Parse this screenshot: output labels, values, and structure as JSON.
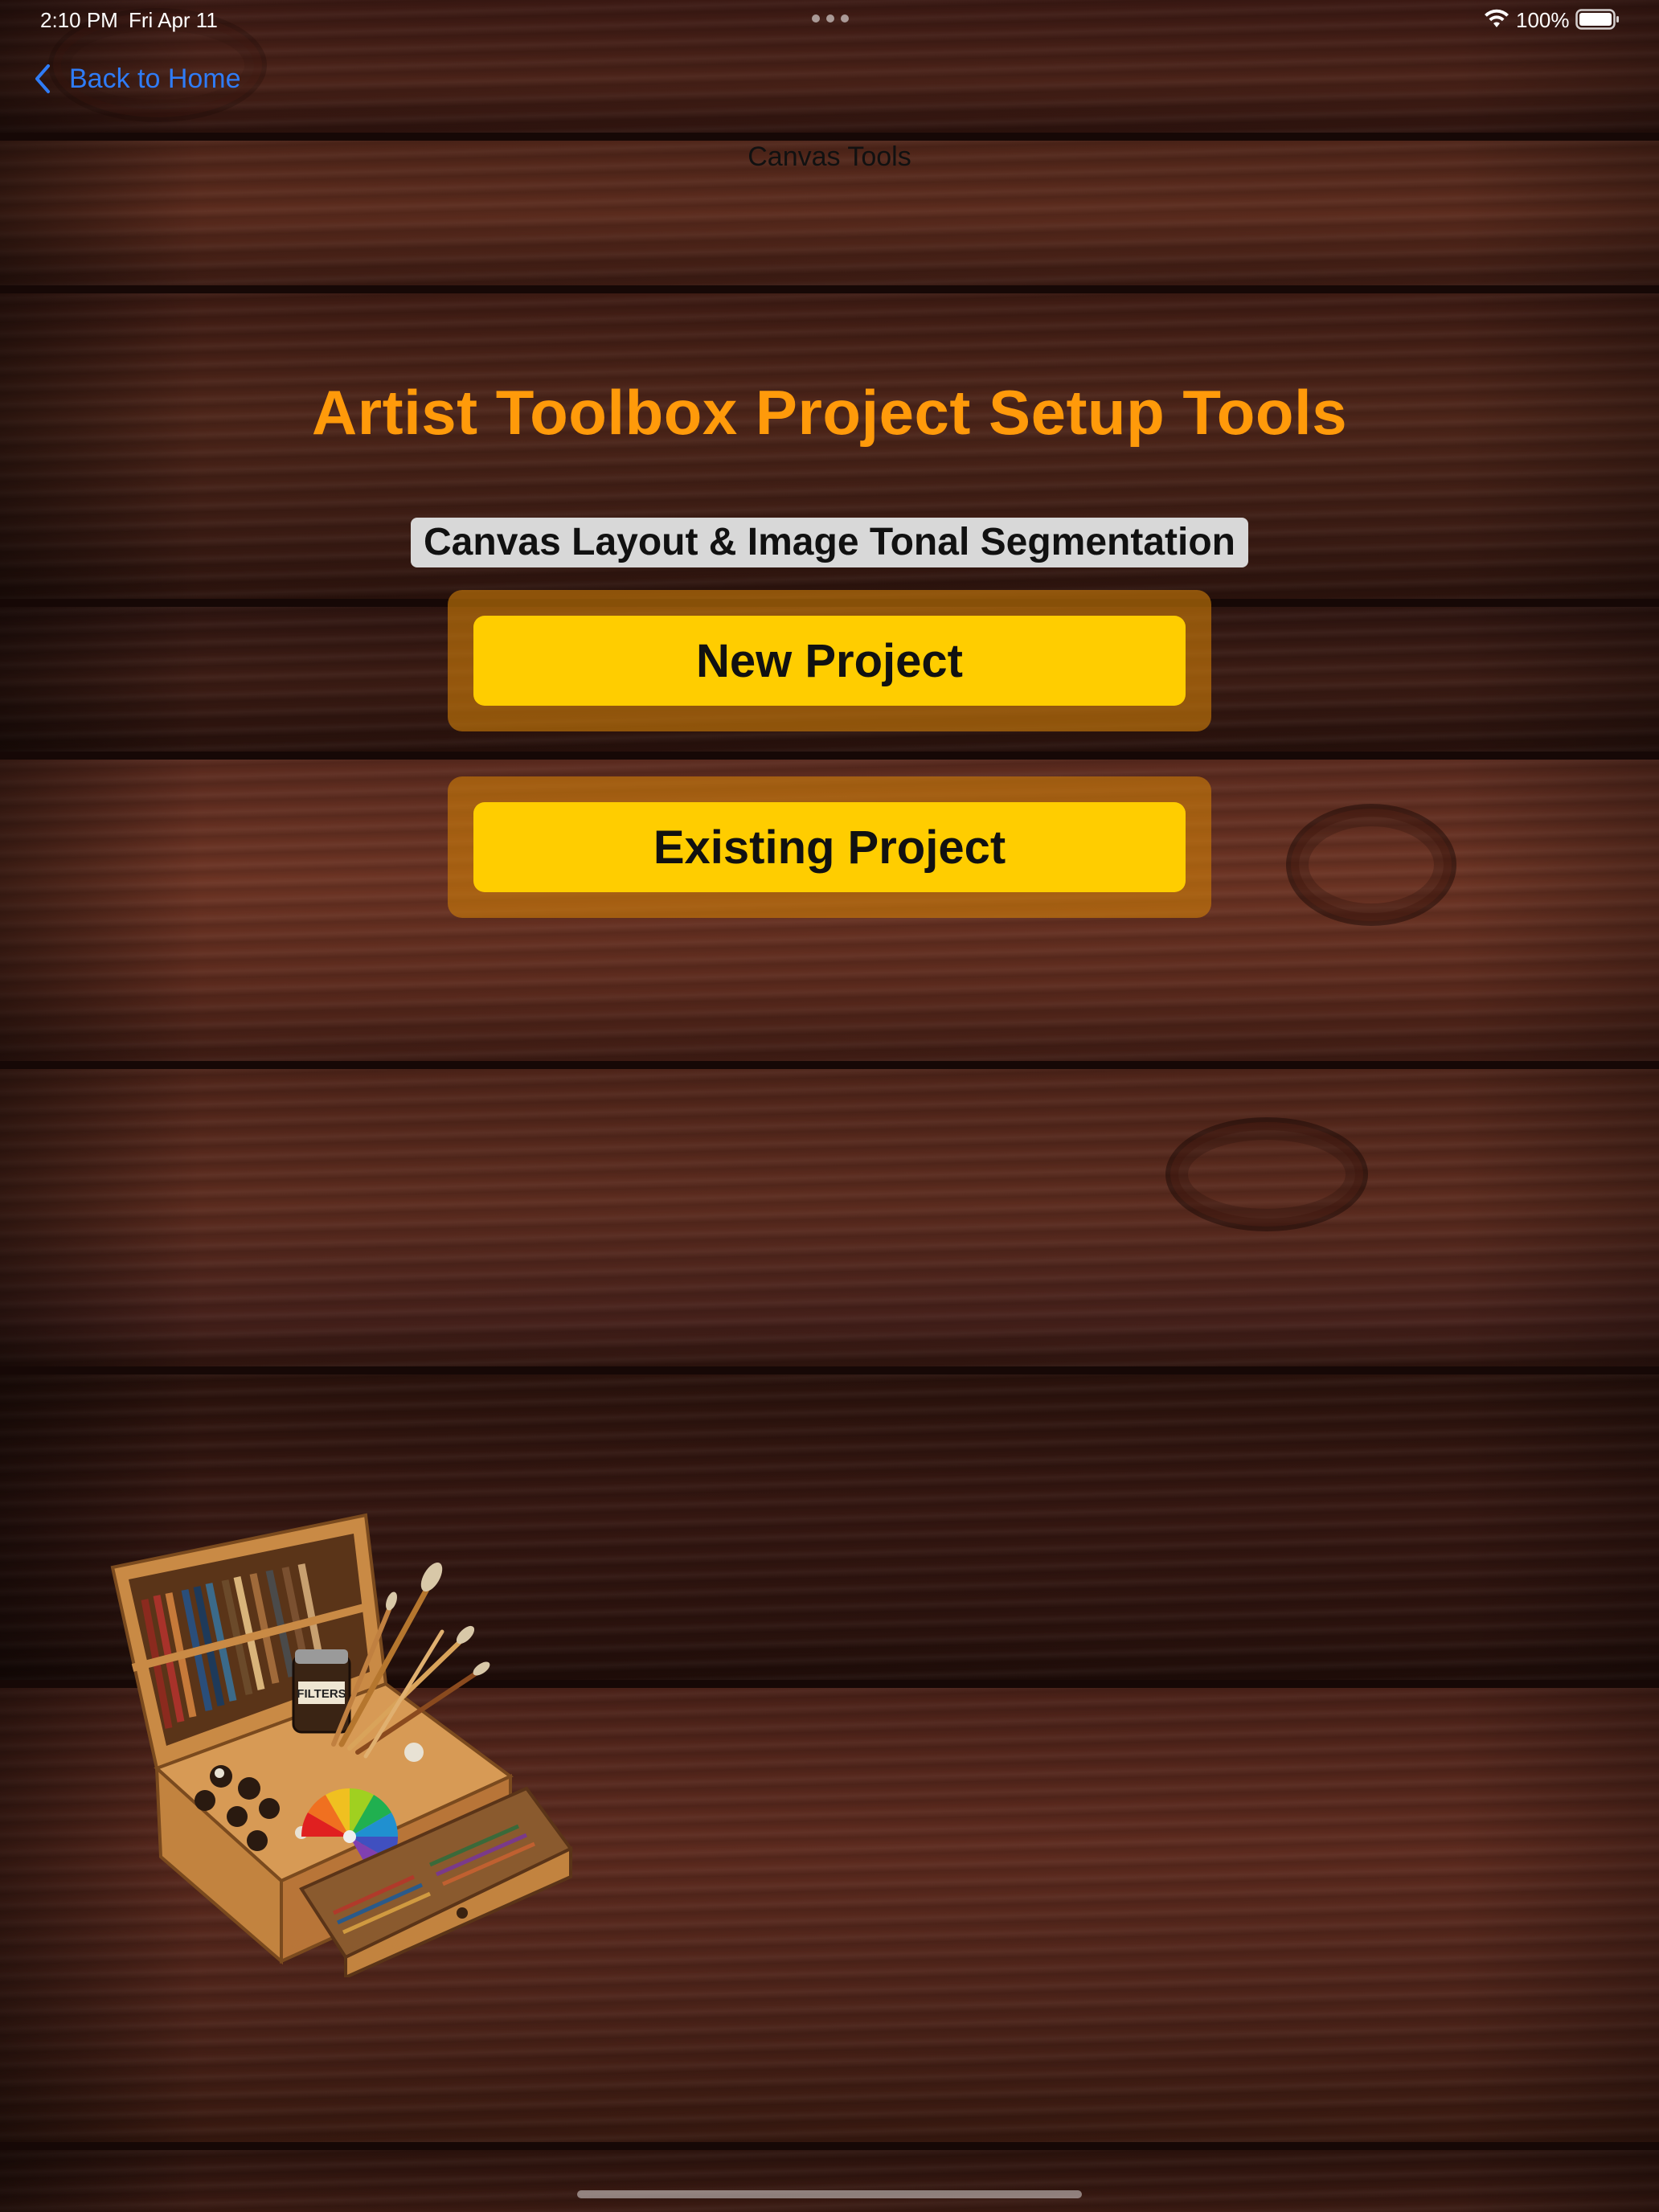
{
  "status_bar": {
    "time": "2:10 PM",
    "date": "Fri Apr 11",
    "battery": "100%",
    "icons": [
      "wifi-icon",
      "battery-icon"
    ]
  },
  "nav": {
    "back_label": "Back to Home",
    "back_icon": "chevron-left-icon",
    "title": "Canvas Tools"
  },
  "main": {
    "title": "Artist Toolbox Project Setup Tools",
    "subtitle": "Canvas Layout & Image Tonal Segmentation",
    "buttons": {
      "new_project": "New Project",
      "existing_project": "Existing Project"
    }
  },
  "illustration": {
    "label": "FILTERS"
  },
  "colors": {
    "accent_title": "#ff9a0a",
    "button_fill": "#ffcd00",
    "button_frame": "#cd7d0a",
    "link_blue": "#2f7cf6"
  }
}
